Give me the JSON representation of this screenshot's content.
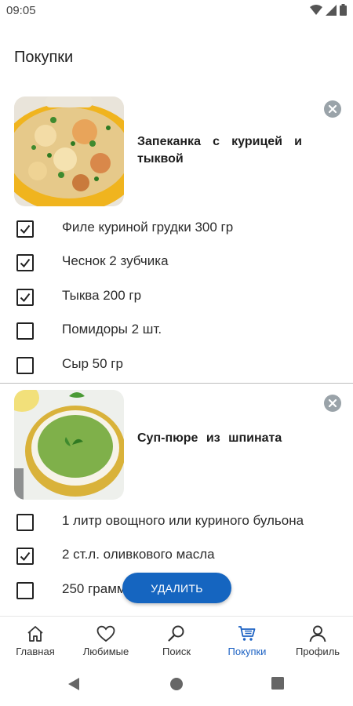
{
  "status": {
    "time": "09:05"
  },
  "page": {
    "title": "Покупки"
  },
  "recipes": [
    {
      "title": "Запеканка с курицей и тыквой",
      "ingredients": [
        {
          "text": "Филе куриной грудки 300 гр",
          "checked": true
        },
        {
          "text": "Чеснок 2 зубчика",
          "checked": true
        },
        {
          "text": "Тыква 200 гр",
          "checked": true
        },
        {
          "text": "Помидоры 2 шт.",
          "checked": false
        },
        {
          "text": "Сыр 50 гр",
          "checked": false
        }
      ]
    },
    {
      "title": "Суп-пюре из шпината",
      "ingredients": [
        {
          "text": "1 литр овощного или куриного бульона",
          "checked": false
        },
        {
          "text": "2 ст.л. оливкового масла",
          "checked": true
        },
        {
          "text": "250 грамм шпината",
          "checked": false
        }
      ]
    }
  ],
  "actions": {
    "delete_label": "УДАЛИТЬ"
  },
  "nav": {
    "items": [
      {
        "label": "Главная",
        "icon": "home-icon"
      },
      {
        "label": "Любимые",
        "icon": "heart-icon"
      },
      {
        "label": "Поиск",
        "icon": "search-icon"
      },
      {
        "label": "Покупки",
        "icon": "cart-icon",
        "active": true
      },
      {
        "label": "Профиль",
        "icon": "profile-icon"
      }
    ]
  },
  "colors": {
    "accent": "#1565c0",
    "active_nav": "#1e63c4"
  }
}
